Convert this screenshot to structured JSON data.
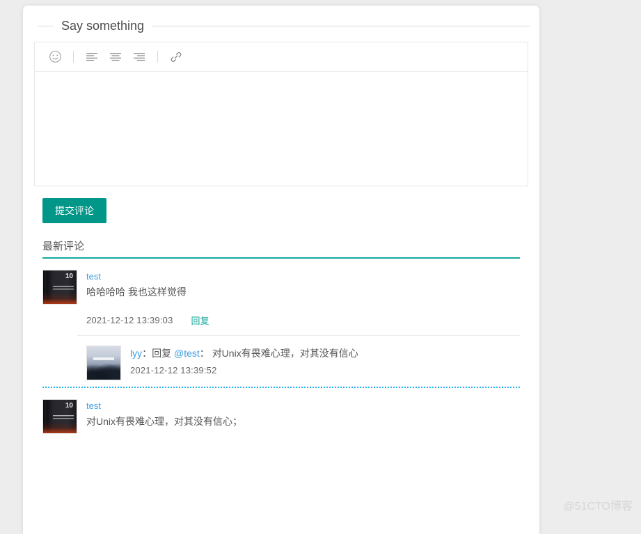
{
  "card": {
    "legend": "Say something",
    "editor": {
      "textarea_value": "",
      "textarea_placeholder": "",
      "toolbar": [
        {
          "name": "emoji-icon",
          "label": "Emoji"
        },
        {
          "name": "align-left-icon",
          "label": "Align left"
        },
        {
          "name": "align-center-icon",
          "label": "Align center"
        },
        {
          "name": "align-right-icon",
          "label": "Align right"
        },
        {
          "name": "link-icon",
          "label": "Insert link"
        }
      ]
    },
    "submit_label": "提交评论",
    "latest_heading": "最新评论"
  },
  "comments": [
    {
      "username": "test",
      "avatar": "book-cover-thumbnail",
      "text": "哈哈哈哈 我也这样觉得",
      "time": "2021-12-12 13:39:03",
      "reply_label": "回复",
      "replies": [
        {
          "username": "lyy",
          "avatar": "mountain-mist-thumbnail",
          "prefix_sep": "：",
          "action": "回复",
          "mention": "@test",
          "mention_sep": "：",
          "text": "对Unix有畏难心理，对其没有信心",
          "time": "2021-12-12 13:39:52"
        }
      ]
    },
    {
      "username": "test",
      "avatar": "book-cover-thumbnail",
      "text": "对Unix有畏难心理，对其没有信心；",
      "time": "",
      "reply_label": "",
      "replies": []
    }
  ],
  "watermark": "@51CTO博客",
  "colors": {
    "accent_teal": "#009688",
    "heading_underline": "#13a89e",
    "link_blue": "#3c9fe0",
    "dotted_separator": "#29b6e8",
    "page_background": "#ededed"
  }
}
